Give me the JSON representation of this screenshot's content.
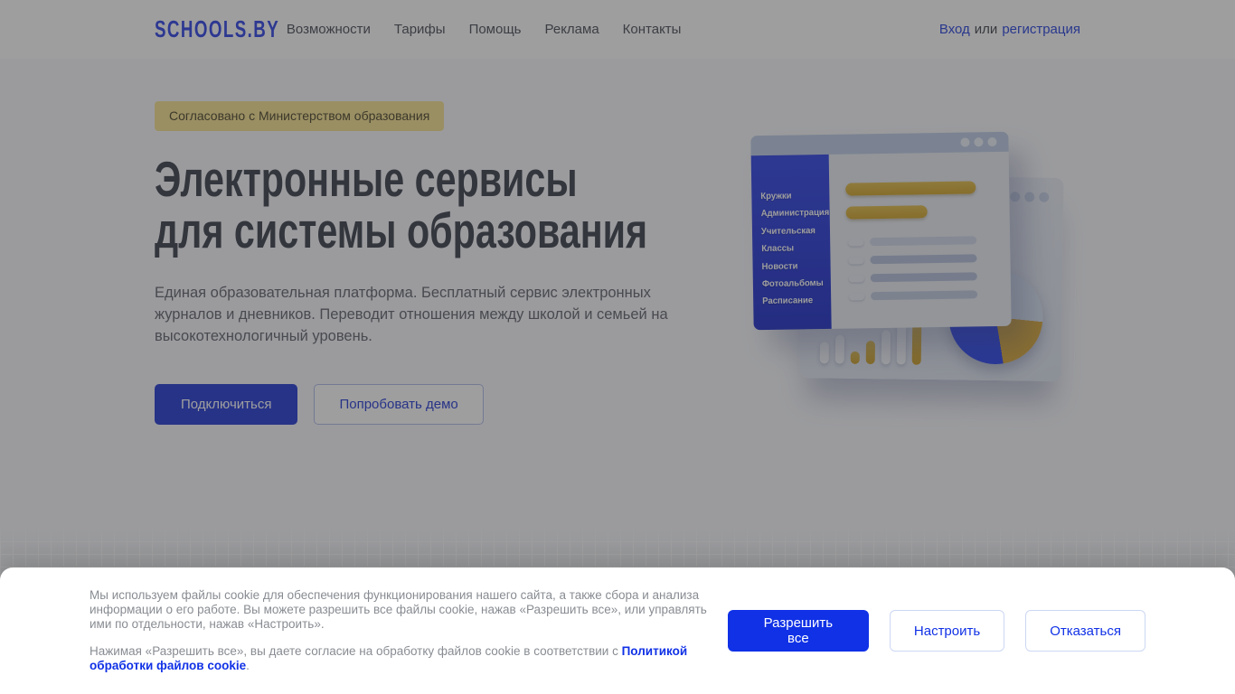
{
  "header": {
    "logo": "SCHOOLS.BY",
    "nav": [
      "Возможности",
      "Тарифы",
      "Помощь",
      "Реклама",
      "Контакты"
    ],
    "auth": {
      "login": "Вход",
      "or": "или",
      "register": "регистрация"
    }
  },
  "hero": {
    "badge": "Согласовано с Министерством образования",
    "title_line1": "Электронные сервисы",
    "title_line2": "для системы образования",
    "description": "Единая образовательная платформа. Бесплатный сервис электронных журналов и дневников. Переводит отношения между школой и семьей на высокотехнологичный уровень.",
    "cta_primary": "Подключиться",
    "cta_secondary": "Попробовать демо"
  },
  "illustration": {
    "menu_items": [
      "Кружки",
      "Администрация",
      "Учительская",
      "Классы",
      "Новости",
      "Фотоальбомы",
      "Расписание"
    ]
  },
  "cookie": {
    "paragraph1": "Мы используем файлы cookie для обеспечения функционирования нашего сайта, а также сбора и анализа информации о его работе. Вы можете разрешить все файлы cookie, нажав «Разрешить все», или управлять ими по отдельности, нажав «Настроить».",
    "paragraph2_prefix": "Нажимая «Разрешить все», вы даете согласие на обработку файлов cookie в соответствии с ",
    "policy_link": "Политикой обработки файлов cookie",
    "paragraph2_suffix": ".",
    "buttons": {
      "allow_all": "Разрешить все",
      "configure": "Настроить",
      "decline": "Отказаться"
    }
  },
  "colors": {
    "brand_blue": "#3a4ed8",
    "cookie_accent_blue": "#1031e6",
    "badge_background": "#f9e79b",
    "sidebar_blue": "#4456e8",
    "chart_yellow": "#ddb94e"
  }
}
